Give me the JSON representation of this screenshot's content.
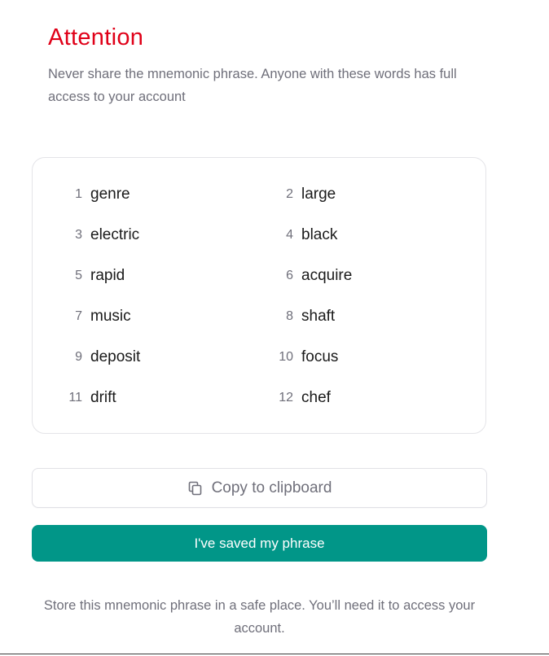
{
  "header": {
    "title": "Attention",
    "warning": "Never share the mnemonic phrase. Anyone with these words has full access to your account"
  },
  "phrase": {
    "words": [
      {
        "number": "1",
        "word": "genre"
      },
      {
        "number": "2",
        "word": "large"
      },
      {
        "number": "3",
        "word": "electric"
      },
      {
        "number": "4",
        "word": "black"
      },
      {
        "number": "5",
        "word": "rapid"
      },
      {
        "number": "6",
        "word": "acquire"
      },
      {
        "number": "7",
        "word": "music"
      },
      {
        "number": "8",
        "word": "shaft"
      },
      {
        "number": "9",
        "word": "deposit"
      },
      {
        "number": "10",
        "word": "focus"
      },
      {
        "number": "11",
        "word": "drift"
      },
      {
        "number": "12",
        "word": "chef"
      }
    ]
  },
  "actions": {
    "copy_label": "Copy to clipboard",
    "copy_icon": "copy-icon",
    "saved_label": "I've saved my phrase"
  },
  "footer": {
    "note": "Store this mnemonic phrase in a safe place. You’ll need it to access your account."
  },
  "colors": {
    "title": "#e00018",
    "primary": "#019688",
    "muted_text": "#6f6f7a"
  }
}
